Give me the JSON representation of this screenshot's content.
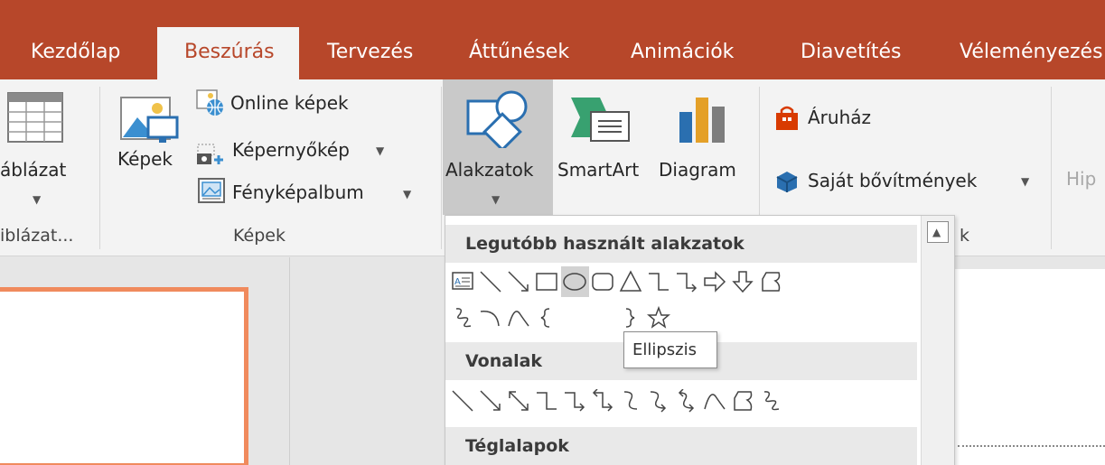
{
  "tabs": [
    {
      "label": "Kezdőlap",
      "active": false
    },
    {
      "label": "Beszúrás",
      "active": true
    },
    {
      "label": "Tervezés",
      "active": false
    },
    {
      "label": "Áttűnések",
      "active": false
    },
    {
      "label": "Animációk",
      "active": false
    },
    {
      "label": "Diavetítés",
      "active": false
    },
    {
      "label": "Véleményezés",
      "active": false
    }
  ],
  "ribbon": {
    "table": {
      "button": "áblázat",
      "group": "iblázat..."
    },
    "images": {
      "pictures": "Képek",
      "online": "Online képek",
      "screenshot": "Képernyőkép",
      "album": "Fényképalbum",
      "group": "Képek"
    },
    "illustrations": {
      "shapes": "Alakzatok",
      "smartart": "SmartArt",
      "chart": "Diagram"
    },
    "addins": {
      "store": "Áruház",
      "my_addins": "Saját bővítmények",
      "group_fragment": "k"
    },
    "links_fragment": "Hip"
  },
  "dropdown": {
    "sections": [
      "Legutóbb használt alakzatok",
      "Vonalak",
      "Téglalapok"
    ]
  },
  "tooltip": "Ellipszis",
  "colors": {
    "accent": "#b7472a",
    "slide_border": "#f08a5d"
  }
}
